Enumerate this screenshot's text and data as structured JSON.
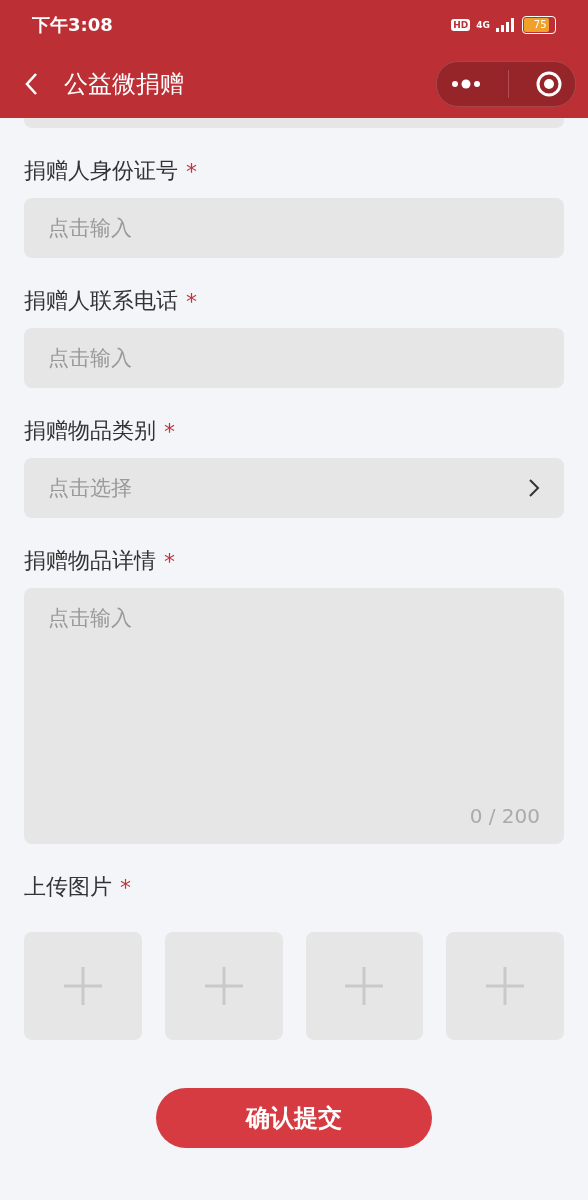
{
  "status_bar": {
    "time": "下午3:08",
    "hd": "HD",
    "network": "4G",
    "battery": "75"
  },
  "nav": {
    "title": "公益微捐赠"
  },
  "fields": [
    {
      "kind": "input",
      "label": "捐赠人身份证号",
      "required_mark": "*",
      "placeholder": "点击输入"
    },
    {
      "kind": "input",
      "label": "捐赠人联系电话",
      "required_mark": "*",
      "placeholder": "点击输入"
    },
    {
      "kind": "select",
      "label": "捐赠物品类别",
      "required_mark": "*",
      "placeholder": "点击选择"
    },
    {
      "kind": "textarea",
      "label": "捐赠物品详情",
      "required_mark": "*",
      "placeholder": "点击输入",
      "counter": "0 / 200"
    }
  ],
  "upload": {
    "label": "上传图片",
    "required_mark": "*",
    "slots": [
      {
        "kind": "add"
      },
      {
        "kind": "add"
      },
      {
        "kind": "add"
      },
      {
        "kind": "add"
      }
    ]
  },
  "submit": {
    "label": "确认提交"
  }
}
